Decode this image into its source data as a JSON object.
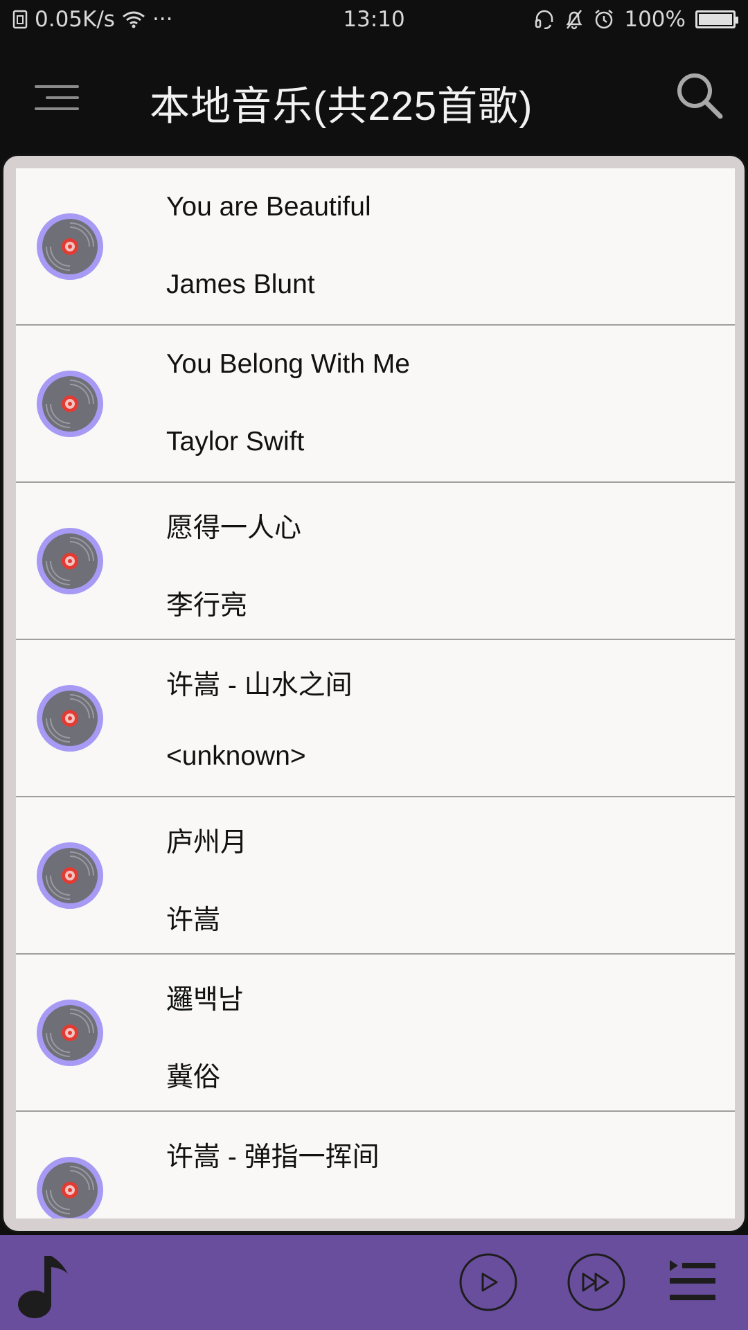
{
  "status_bar": {
    "net_speed": "0.05K/s",
    "dots": "···",
    "time": "13:10",
    "battery": "100%"
  },
  "app_bar": {
    "title": "本地音乐(共225首歌)"
  },
  "songs": [
    {
      "title": "You are Beautiful",
      "artist": "James Blunt"
    },
    {
      "title": "You Belong With Me",
      "artist": "Taylor Swift"
    },
    {
      "title": "愿得一人心",
      "artist": "李行亮"
    },
    {
      "title": "许嵩 - 山水之间",
      "artist": "<unknown>"
    },
    {
      "title": "庐州月",
      "artist": "许嵩"
    },
    {
      "title": "邏백남",
      "artist": "冀俗"
    },
    {
      "title": "许嵩 - 弹指一挥间",
      "artist": ""
    }
  ],
  "icons": {
    "menu": "menu-icon",
    "search": "search-icon",
    "disc": "vinyl-disc-icon",
    "note": "music-note-icon",
    "play": "play-icon",
    "next": "skip-next-icon",
    "queue": "playlist-icon"
  },
  "colors": {
    "app_bar_bg": "#0f0f0f",
    "player_bar_bg": "#6a4e9e",
    "disc_bg": "#a79af5",
    "list_bg": "#f9f8f7"
  }
}
